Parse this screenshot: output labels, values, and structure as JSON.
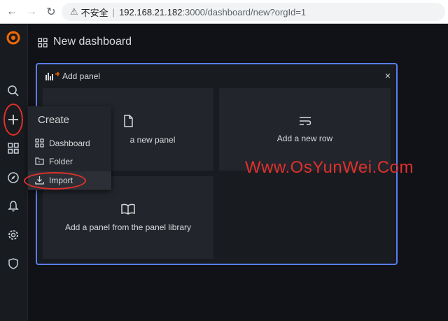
{
  "browser": {
    "security_label": "不安全",
    "url_host": "192.168.21.182",
    "url_rest": ":3000/dashboard/new?orgId=1"
  },
  "header": {
    "title": "New dashboard"
  },
  "add_panel": {
    "title": "Add panel",
    "close": "×",
    "tiles": {
      "new_panel": "a new panel",
      "new_row": "Add a new row",
      "library": "Add a panel from the panel library"
    }
  },
  "create_menu": {
    "heading": "Create",
    "items": [
      {
        "label": "Dashboard",
        "icon": "grid-icon"
      },
      {
        "label": "Folder",
        "icon": "folder-icon"
      },
      {
        "label": "Import",
        "icon": "import-icon"
      }
    ]
  },
  "sidebar": {
    "icons": [
      "grafana-logo",
      "search-icon",
      "plus-icon",
      "grid-icon",
      "compass-icon",
      "bell-icon",
      "gear-icon",
      "shield-icon"
    ]
  },
  "watermark": "Www.OsYunWei.Com",
  "colors": {
    "accent_border": "#5a7cf0",
    "annotation_red": "#e0302c",
    "grafana_orange": "#f46800"
  }
}
